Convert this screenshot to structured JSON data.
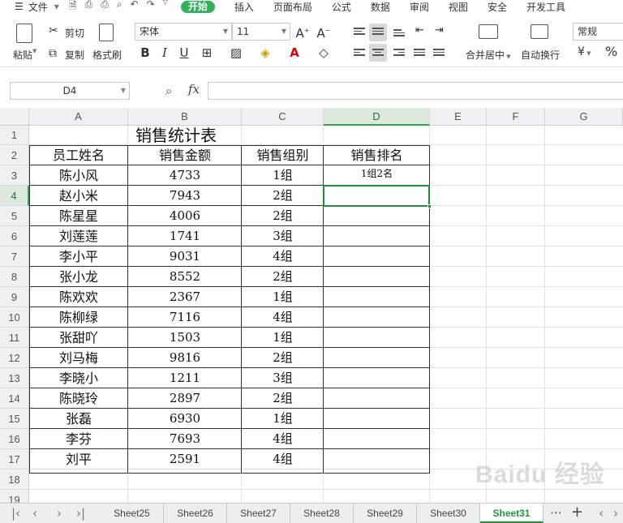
{
  "menu": {
    "file": "文件",
    "tabs": [
      "开始",
      "插入",
      "页面布局",
      "公式",
      "数据",
      "审阅",
      "视图",
      "安全",
      "开发工具"
    ]
  },
  "ribbon": {
    "paste": "粘贴",
    "cut": "剪切",
    "copy": "复制",
    "format_painter": "格式刷",
    "font_name": "宋体",
    "font_size": "11",
    "merge_center": "合并居中",
    "wrap_text": "自动换行",
    "number_format": "常规"
  },
  "formula_bar": {
    "name_box": "D4",
    "fx": "fx",
    "content": ""
  },
  "grid": {
    "columns": [
      "A",
      "B",
      "C",
      "D",
      "E",
      "F",
      "G"
    ],
    "rows": [
      "1",
      "2",
      "3",
      "4",
      "5",
      "6",
      "7",
      "8",
      "9",
      "10",
      "11",
      "12",
      "13",
      "14",
      "15",
      "16",
      "17",
      "18",
      "19"
    ],
    "title": "销售统计表",
    "headers": [
      "员工姓名",
      "销售金额",
      "销售组别",
      "销售排名"
    ],
    "data": [
      [
        "陈小风",
        "4733",
        "1组",
        "1组2名"
      ],
      [
        "赵小米",
        "7943",
        "2组",
        ""
      ],
      [
        "陈星星",
        "4006",
        "2组",
        ""
      ],
      [
        "刘莲莲",
        "1741",
        "3组",
        ""
      ],
      [
        "李小平",
        "9031",
        "4组",
        ""
      ],
      [
        "张小龙",
        "8552",
        "2组",
        ""
      ],
      [
        "陈欢欢",
        "2367",
        "1组",
        ""
      ],
      [
        "陈柳绿",
        "7116",
        "4组",
        ""
      ],
      [
        "张甜吖",
        "1503",
        "1组",
        ""
      ],
      [
        "刘马梅",
        "9816",
        "2组",
        ""
      ],
      [
        "李晓小",
        "1211",
        "3组",
        ""
      ],
      [
        "陈晓玲",
        "2897",
        "2组",
        ""
      ],
      [
        "张磊",
        "6930",
        "1组",
        ""
      ],
      [
        "李芬",
        "7693",
        "4组",
        ""
      ],
      [
        "刘平",
        "2591",
        "4组",
        ""
      ]
    ]
  },
  "sheet_tabs": {
    "tabs": [
      "Sheet25",
      "Sheet26",
      "Sheet27",
      "Sheet28",
      "Sheet29",
      "Sheet30",
      "Sheet31"
    ],
    "active": "Sheet31",
    "more": "⋯",
    "add": "+"
  },
  "watermark": "Baidu 经验",
  "colors": {
    "accent": "#2fb35a",
    "selection": "#1e8f3e"
  }
}
